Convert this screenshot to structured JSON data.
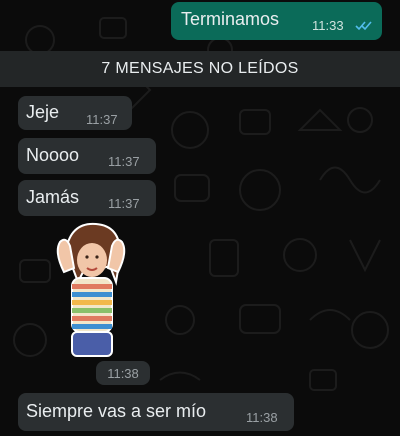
{
  "outgoing": {
    "text": "Terminamos",
    "time": "11:33"
  },
  "unread_banner": "7 MENSAJES NO LEÍDOS",
  "incoming": [
    {
      "text": "Jeje",
      "time": "11:37"
    },
    {
      "text": "Noooo",
      "time": "11:37"
    },
    {
      "text": "Jamás",
      "time": "11:37"
    }
  ],
  "sticker": {
    "time": "11:38"
  },
  "last_message": {
    "text": "Siempre vas a ser mío",
    "time": "11:38"
  },
  "colors": {
    "background": "#0b0b0b",
    "outgoing_bubble": "#0b6b59",
    "incoming_bubble": "#2b2f31",
    "read_ticks": "#53bdeb"
  }
}
